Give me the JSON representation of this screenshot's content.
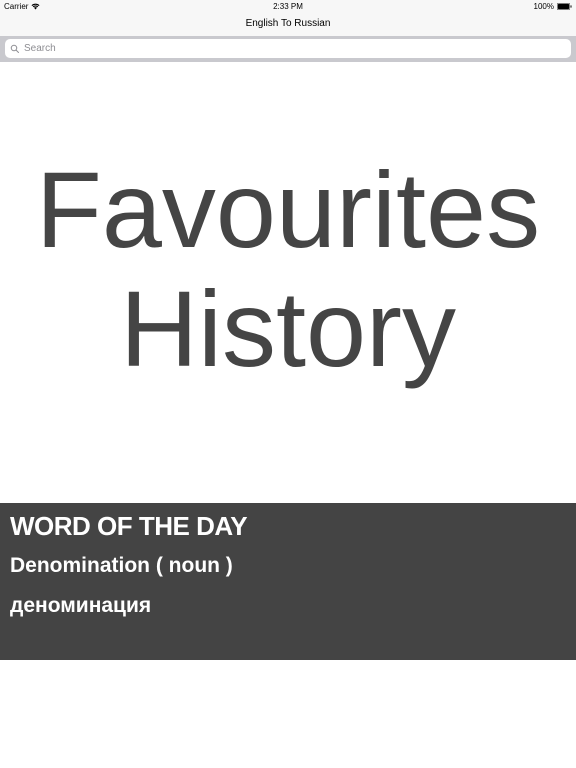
{
  "status_bar": {
    "carrier": "Carrier",
    "time": "2:33 PM",
    "battery": "100%"
  },
  "nav": {
    "title": "English To Russian"
  },
  "search": {
    "placeholder": "Search",
    "value": ""
  },
  "menu": {
    "favourites_label": "Favourites",
    "history_label": "History"
  },
  "word_of_the_day": {
    "heading": "WORD OF THE DAY",
    "word": "Denomination ( noun )",
    "translation": "деноминация"
  },
  "icons": {
    "wifi": "wifi-icon",
    "battery": "battery-icon",
    "search": "search-icon"
  },
  "colors": {
    "menu_text": "#454545",
    "panel_background": "#444444",
    "panel_text": "#ffffff",
    "search_bar_background": "#c9c9ce"
  }
}
